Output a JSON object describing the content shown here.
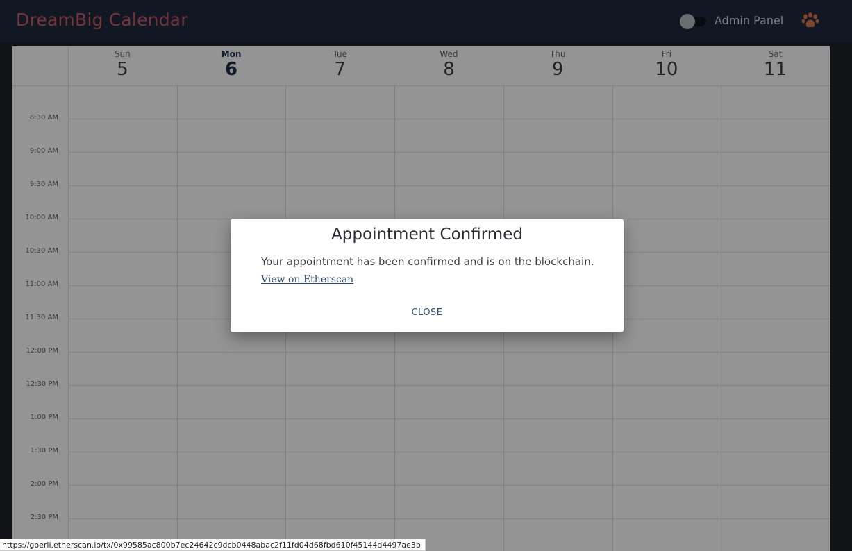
{
  "app": {
    "brand": "DreamBig Calendar",
    "admin_label": "Admin Panel",
    "admin_toggle_on": false,
    "accent_color": "#c95a65",
    "paw_color": "#d97b4f"
  },
  "calendar": {
    "days": [
      {
        "name": "Sun",
        "num": "5",
        "today": false
      },
      {
        "name": "Mon",
        "num": "6",
        "today": true
      },
      {
        "name": "Tue",
        "num": "7",
        "today": false
      },
      {
        "name": "Wed",
        "num": "8",
        "today": false
      },
      {
        "name": "Thu",
        "num": "9",
        "today": false
      },
      {
        "name": "Fri",
        "num": "10",
        "today": false
      },
      {
        "name": "Sat",
        "num": "11",
        "today": false
      }
    ],
    "times": [
      "8:30 AM",
      "9:00 AM",
      "9:30 AM",
      "10:00 AM",
      "10:30 AM",
      "11:00 AM",
      "11:30 AM",
      "12:00 PM",
      "12:30 PM",
      "1:00 PM",
      "1:30 PM",
      "2:00 PM",
      "2:30 PM"
    ]
  },
  "dialog": {
    "title": "Appointment Confirmed",
    "message": "Your appointment has been confirmed and is on the blockchain.",
    "link": "View on Etherscan",
    "close": "CLOSE"
  },
  "status_url": "https://goerli.etherscan.io/tx/0x99585ac800b7ec24642c9dcb0448abac2f11fd04d68fbd610f45144d4497ae3b"
}
